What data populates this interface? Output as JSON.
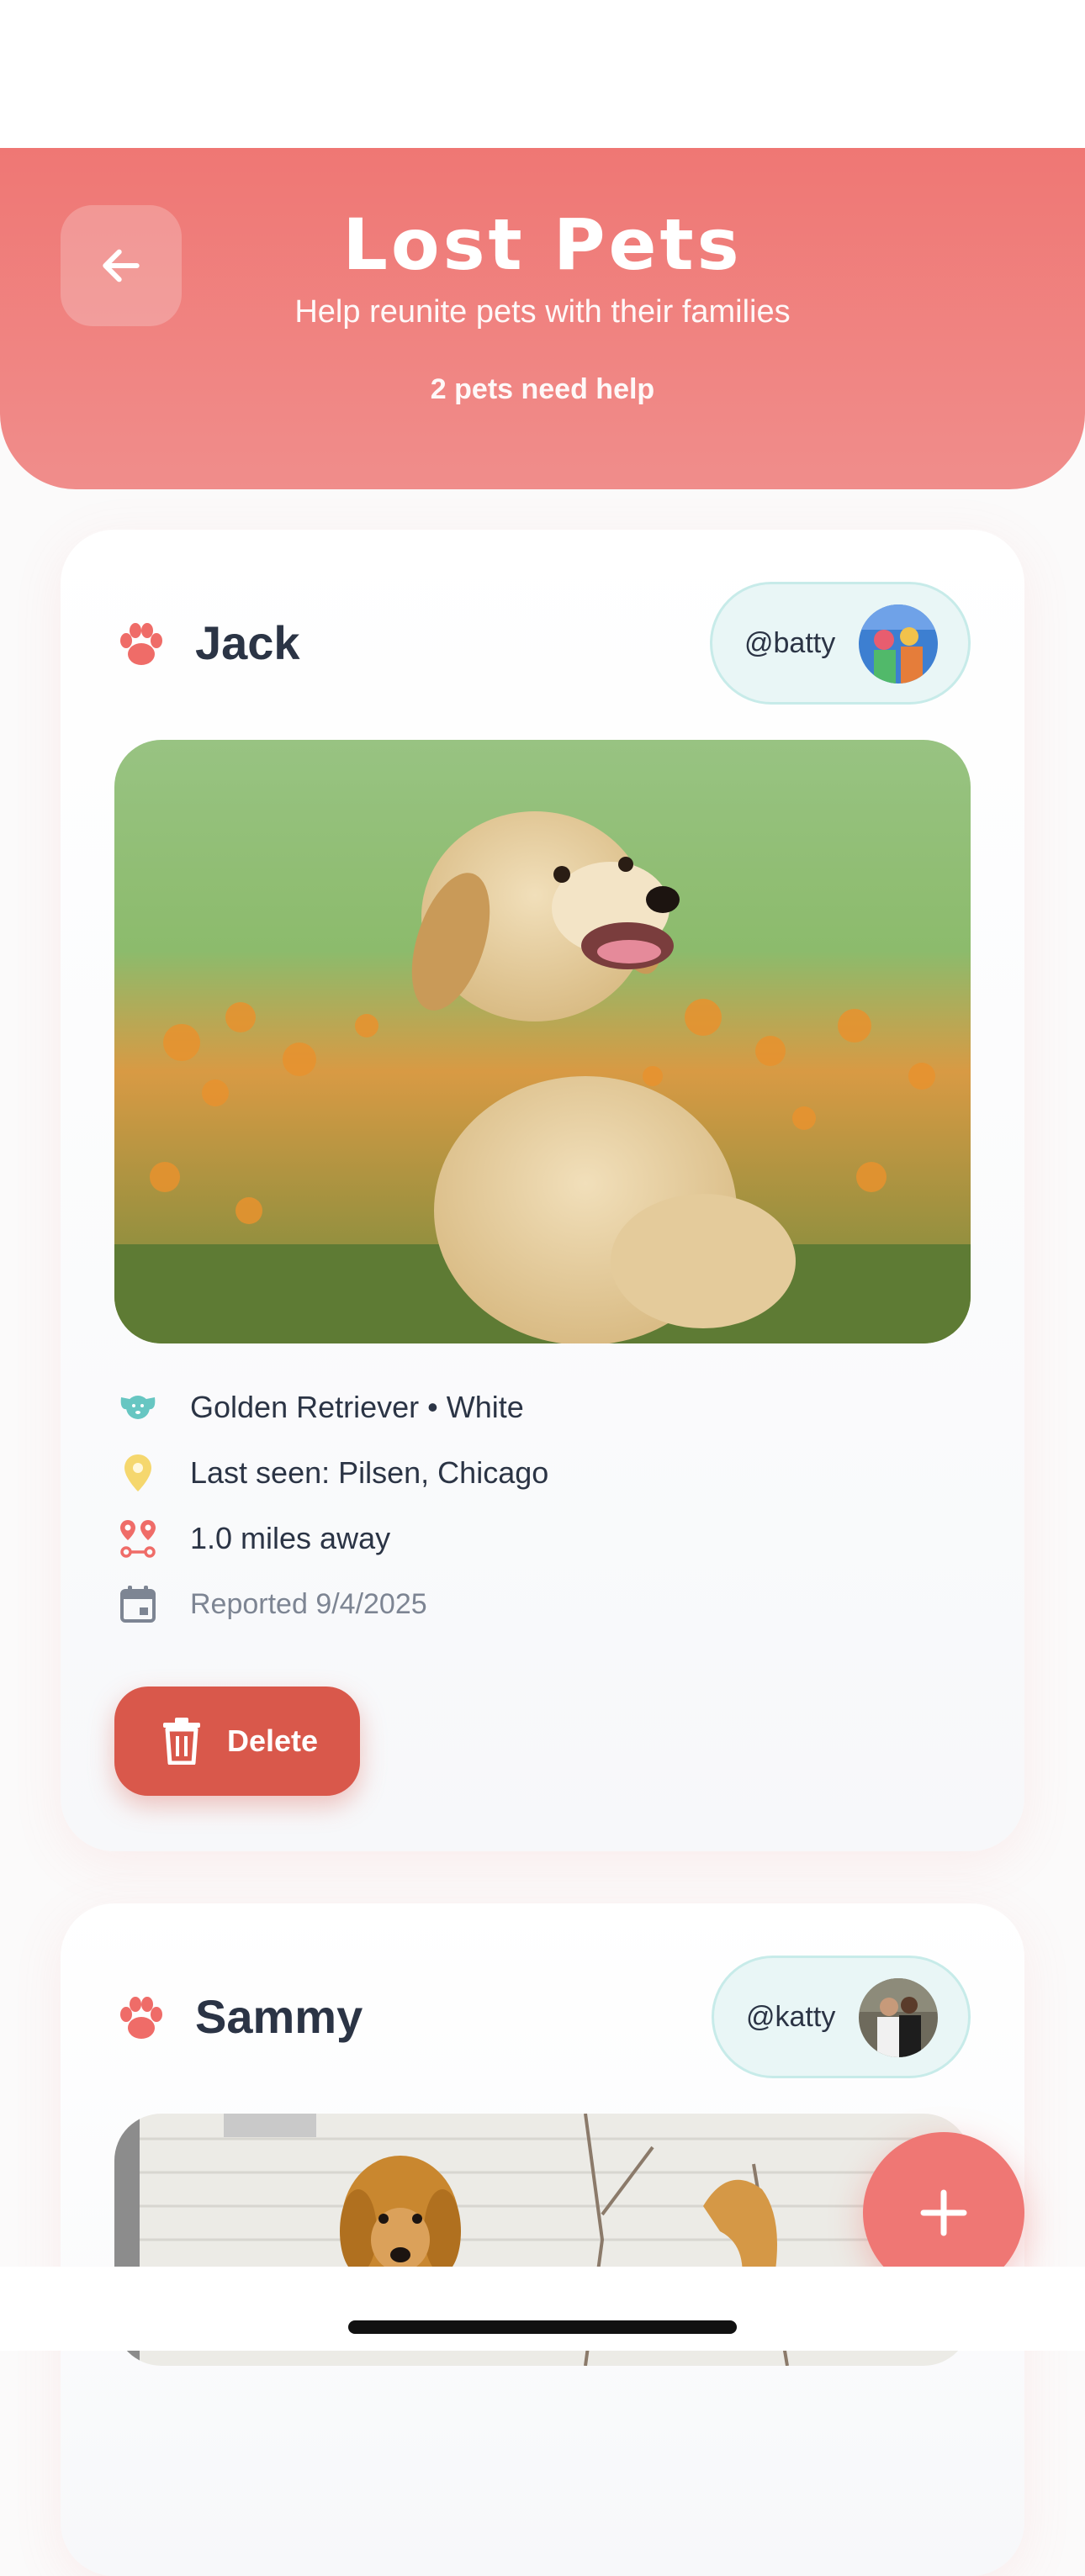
{
  "header": {
    "title": "Lost Pets",
    "subtitle": "Help reunite pets with their families",
    "count_text": "2 pets need help"
  },
  "pets": [
    {
      "name": "Jack",
      "username": "@batty",
      "breed_color": "Golden Retriever • White",
      "last_seen": "Last seen: Pilsen, Chicago",
      "distance": "1.0 miles away",
      "reported": "Reported 9/4/2025",
      "delete_label": "Delete"
    },
    {
      "name": "Sammy",
      "username": "@katty"
    }
  ],
  "icons": {
    "back": "arrow-left-icon",
    "paw": "paw-icon",
    "breed": "dog-face-icon",
    "location": "location-pin-icon",
    "distance": "route-icon",
    "calendar": "calendar-icon",
    "delete": "trash-icon",
    "add": "plus-icon"
  },
  "colors": {
    "accent": "#ef7774",
    "delete": "#d9584b",
    "teal": "#67c6c2",
    "yellow": "#f5d76e"
  }
}
